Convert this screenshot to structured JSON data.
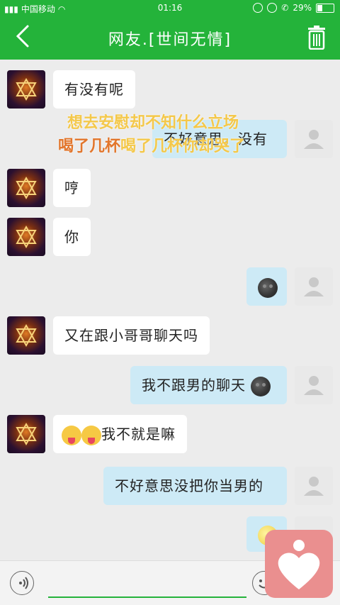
{
  "status_bar": {
    "carrier": "中国移动",
    "time": "01:16",
    "battery": "29%"
  },
  "header": {
    "title": "网友.[世间无情]"
  },
  "messages": [
    {
      "side": "in",
      "text": "有没有呢"
    },
    {
      "side": "out",
      "text": "不好意思，没有"
    },
    {
      "side": "in",
      "text": "哼"
    },
    {
      "side": "in",
      "text": "你"
    },
    {
      "side": "out",
      "text": ""
    },
    {
      "side": "in",
      "text": "又在跟小哥哥聊天吗"
    },
    {
      "side": "out",
      "text": "我不跟男的聊天"
    },
    {
      "side": "in",
      "text": "我不就是嘛"
    },
    {
      "side": "out",
      "text": "不好意思没把你当男的"
    },
    {
      "side": "out",
      "text": ""
    }
  ],
  "overlay": {
    "line1": "想去安慰却不知什么立场",
    "line2a": "喝了几杯",
    "line2b": "喝了几杯你却哭了"
  },
  "colors": {
    "accent": "#24b33a",
    "incoming_bubble": "#ffffff",
    "outgoing_bubble": "#cdeaf6"
  }
}
